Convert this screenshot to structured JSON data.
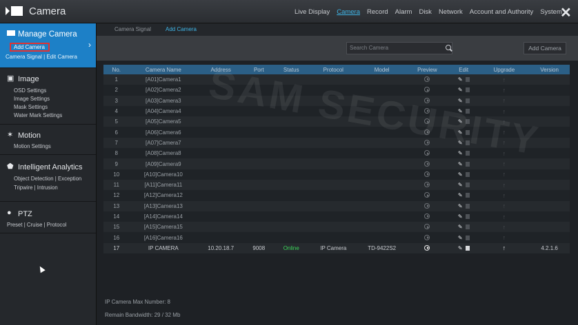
{
  "app": {
    "title": "Camera"
  },
  "topnav": [
    "Live Display",
    "Camera",
    "Record",
    "Alarm",
    "Disk",
    "Network",
    "Account and Authority",
    "System"
  ],
  "topnav_active": "Camera",
  "sidebar": {
    "manage": {
      "title": "Manage Camera",
      "add": "Add Camera",
      "links": [
        "Camera Signal",
        "Edit Camera"
      ]
    },
    "image": {
      "title": "Image",
      "items": [
        "OSD Settings",
        "Image Settings",
        "Mask Settings",
        "Water Mark Settings"
      ]
    },
    "motion": {
      "title": "Motion",
      "items": [
        "Motion Settings"
      ]
    },
    "ia": {
      "title": "Intelligent Analytics",
      "items": [
        "Object Detection",
        "Exception",
        "Tripwire",
        "Intrusion"
      ]
    },
    "ptz": {
      "title": "PTZ",
      "items": [
        "Preset",
        "Cruise",
        "Protocol"
      ]
    }
  },
  "subtabs": [
    "Camera Signal",
    "Add Camera"
  ],
  "toolbar": {
    "search_placeholder": "Search Camera",
    "add_button": "Add Camera"
  },
  "table": {
    "headers": [
      "No.",
      "Camera Name",
      "Address",
      "Port",
      "Status",
      "Protocol",
      "Model",
      "Preview",
      "Edit",
      "Upgrade",
      "Version"
    ],
    "rows": [
      [
        "1",
        "[A01]Camera1",
        "",
        "",
        "",
        "",
        ""
      ],
      [
        "2",
        "[A02]Camera2",
        "",
        "",
        "",
        "",
        ""
      ],
      [
        "3",
        "[A03]Camera3",
        "",
        "",
        "",
        "",
        ""
      ],
      [
        "4",
        "[A04]Camera4",
        "",
        "",
        "",
        "",
        ""
      ],
      [
        "5",
        "[A05]Camera5",
        "",
        "",
        "",
        "",
        ""
      ],
      [
        "6",
        "[A06]Camera6",
        "",
        "",
        "",
        "",
        ""
      ],
      [
        "7",
        "[A07]Camera7",
        "",
        "",
        "",
        "",
        ""
      ],
      [
        "8",
        "[A08]Camera8",
        "",
        "",
        "",
        "",
        ""
      ],
      [
        "9",
        "[A09]Camera9",
        "",
        "",
        "",
        "",
        ""
      ],
      [
        "10",
        "[A10]Camera10",
        "",
        "",
        "",
        "",
        ""
      ],
      [
        "11",
        "[A11]Camera11",
        "",
        "",
        "",
        "",
        ""
      ],
      [
        "12",
        "[A12]Camera12",
        "",
        "",
        "",
        "",
        ""
      ],
      [
        "13",
        "[A13]Camera13",
        "",
        "",
        "",
        "",
        ""
      ],
      [
        "14",
        "[A14]Camera14",
        "",
        "",
        "",
        "",
        ""
      ],
      [
        "15",
        "[A15]Camera15",
        "",
        "",
        "",
        "",
        ""
      ],
      [
        "16",
        "[A16]Camera16",
        "",
        "",
        "",
        "",
        ""
      ],
      [
        "17",
        "IP CAMERA",
        "10.20.18.7",
        "9008",
        "Online",
        "IP Camera",
        "TD-9422S2",
        "4.2.1.6"
      ]
    ]
  },
  "footer": {
    "max": "IP Camera Max Number: 8",
    "bandwidth": "Remain Bandwidth: 29 / 32 Mb"
  },
  "watermark": "SAM SECURITY",
  "colors": {
    "accent": "#1d80c7",
    "online": "#3cd45a",
    "highlight": "#e23232"
  }
}
